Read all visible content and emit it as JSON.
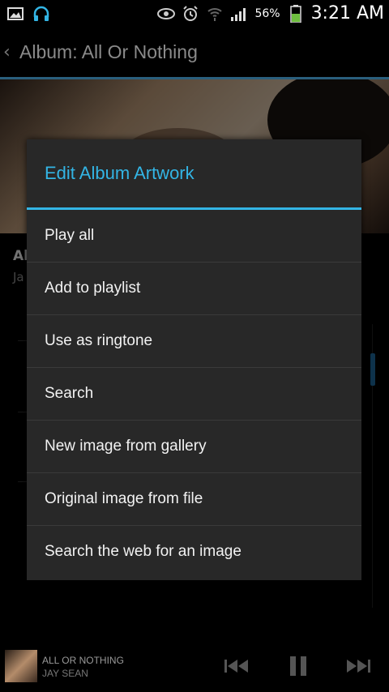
{
  "status_bar": {
    "battery_percent": "56%",
    "time": "3:21 AM",
    "icons": [
      "image-icon",
      "headphones-icon",
      "eye-icon",
      "alarm-icon",
      "wifi-icon",
      "signal-icon",
      "battery-icon"
    ]
  },
  "action_bar": {
    "title": "Album: All Or Nothing"
  },
  "album_info": {
    "title": "Al",
    "artist": "Ja"
  },
  "dialog": {
    "title": "Edit Album Artwork",
    "items": [
      {
        "label": "Play all"
      },
      {
        "label": "Add to playlist"
      },
      {
        "label": "Use as ringtone"
      },
      {
        "label": "Search"
      },
      {
        "label": "New image from gallery"
      },
      {
        "label": "Original image from file"
      },
      {
        "label": "Search the web for an image"
      }
    ]
  },
  "mini_player": {
    "title": "ALL OR NOTHING",
    "artist": "JAY SEAN"
  },
  "colors": {
    "accent": "#33b5e5",
    "dialog_bg": "#282828",
    "background": "#000000"
  }
}
